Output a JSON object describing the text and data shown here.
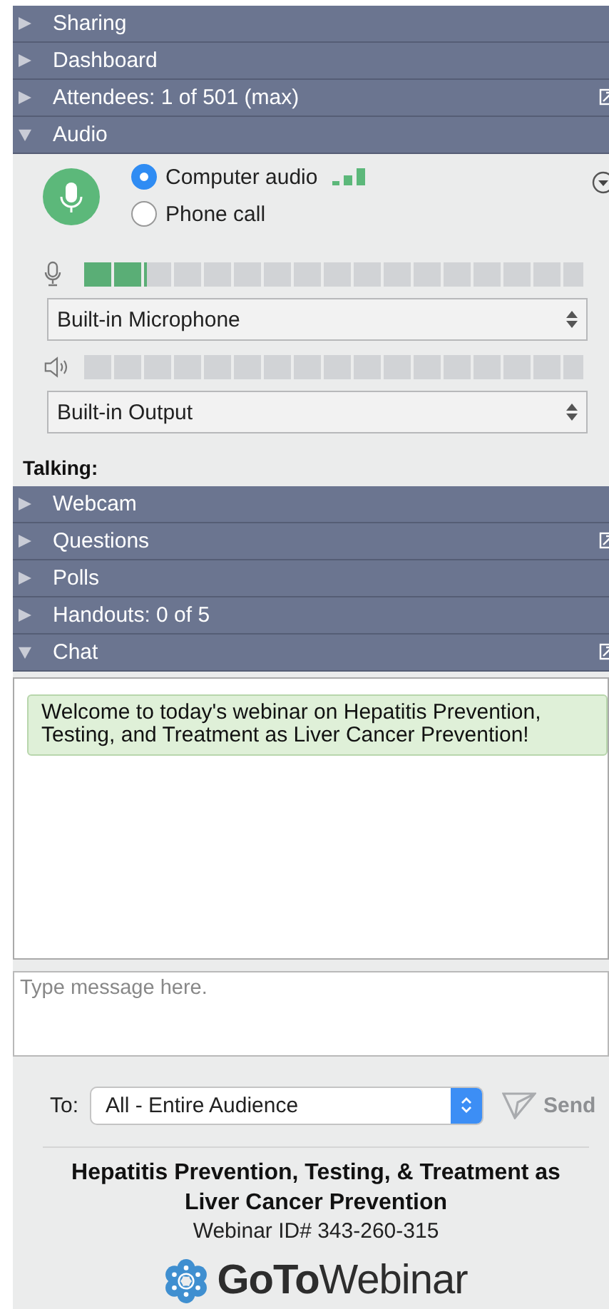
{
  "sections": [
    {
      "label": "Sharing",
      "expanded": false,
      "popout": false
    },
    {
      "label": "Dashboard",
      "expanded": false,
      "popout": false
    },
    {
      "label": "Attendees: 1 of 501 (max)",
      "expanded": false,
      "popout": true
    },
    {
      "label": "Audio",
      "kind": "audio",
      "expanded": true,
      "popout": false
    },
    {
      "label": "Webcam",
      "expanded": false,
      "popout": false
    },
    {
      "label": "Questions",
      "expanded": false,
      "popout": true
    },
    {
      "label": "Polls",
      "expanded": false,
      "popout": false
    },
    {
      "label": "Handouts: 0 of 5",
      "expanded": false,
      "popout": false
    },
    {
      "label": "Chat",
      "kind": "chat",
      "expanded": true,
      "popout": true
    }
  ],
  "audio": {
    "modes": [
      {
        "label": "Computer audio",
        "selected": true
      },
      {
        "label": "Phone call",
        "selected": false
      }
    ],
    "microphone": {
      "level": 0.125,
      "device": "Built-in Microphone"
    },
    "speaker": {
      "level": 0,
      "device": "Built-in Output"
    },
    "talking_label": "Talking:"
  },
  "chat": {
    "messages": [
      {
        "text": "Welcome to today's webinar on Hepatitis Prevention, Testing, and Treatment as Liver Cancer Prevention!"
      }
    ],
    "input": {
      "placeholder": "Type message here."
    },
    "to_label": "To:",
    "recipient": "All - Entire Audience",
    "send": "Send"
  },
  "footer": {
    "title": "Hepatitis Prevention, Testing, & Treatment as Liver Cancer Prevention",
    "webinar_id": "Webinar ID# 343-260-315",
    "logo": "**GoTo**Webinar"
  }
}
